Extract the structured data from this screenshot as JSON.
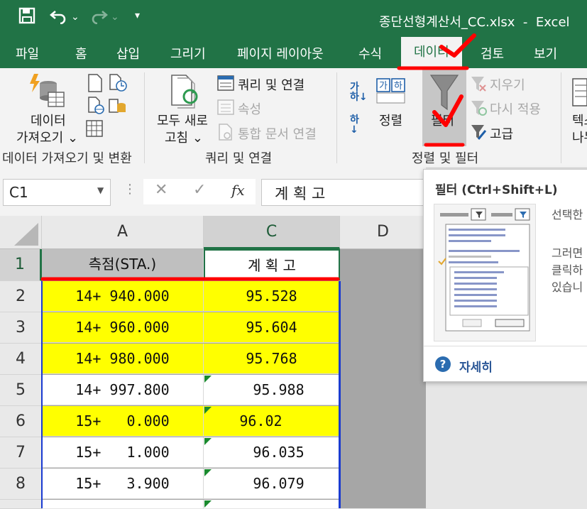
{
  "window": {
    "title": "종단선형계산서_CC.xlsx  -  Excel"
  },
  "tabs": [
    "파일",
    "홈",
    "삽입",
    "그리기",
    "페이지 레이아웃",
    "수식",
    "데이터",
    "검토",
    "보기"
  ],
  "active_tab": "데이터",
  "ribbon": {
    "get_data": {
      "line1": "데이터",
      "line2": "가져오기 ⌄"
    },
    "refresh_all": {
      "line1": "모두 새로",
      "line2": "고침 ⌄"
    },
    "queries_connections": "쿼리 및 연결",
    "properties": "속성",
    "edit_links": "통합 문서 연결",
    "sort": "정렬",
    "filter": "필터",
    "clear": "지우기",
    "reapply": "다시 적용",
    "advanced": "고급",
    "text_to_columns": {
      "line1": "텍스",
      "line2": "나누"
    },
    "sort_az_icon_text": "가\n하",
    "sort_za_icon_text": "하",
    "groups": {
      "get_transform": "데이터 가져오기 및 변환",
      "queries": "쿼리 및 연결",
      "sort_filter": "정렬 및 필터"
    }
  },
  "formula_bar": {
    "name_box": "C1",
    "content": "계 획 고",
    "fx": "fx"
  },
  "grid": {
    "columns": [
      "A",
      "C",
      "D"
    ],
    "rows": [
      {
        "num": "1",
        "a": "측점(STA.)",
        "c": "계 획 고"
      },
      {
        "num": "2",
        "a": "14+ 940.000",
        "c": "95.528"
      },
      {
        "num": "3",
        "a": "14+ 960.000",
        "c": "95.604"
      },
      {
        "num": "4",
        "a": "14+ 980.000",
        "c": "95.768"
      },
      {
        "num": "5",
        "a": "14+ 997.800",
        "c": "95.988"
      },
      {
        "num": "6",
        "a": "15+   0.000",
        "c": "96.02"
      },
      {
        "num": "7",
        "a": "15+   1.000",
        "c": "96.035"
      },
      {
        "num": "8",
        "a": "15+   3.900",
        "c": "96.079"
      }
    ]
  },
  "tooltip": {
    "title": "필터 (Ctrl+Shift+L)",
    "desc1": "선택한",
    "desc2_lines": [
      "그러면",
      "클릭하",
      "있습니"
    ],
    "more": "자세히"
  },
  "colors": {
    "excel_green": "#217346",
    "highlight_yellow": "#ffff00",
    "annotation_red": "#ff0000"
  }
}
